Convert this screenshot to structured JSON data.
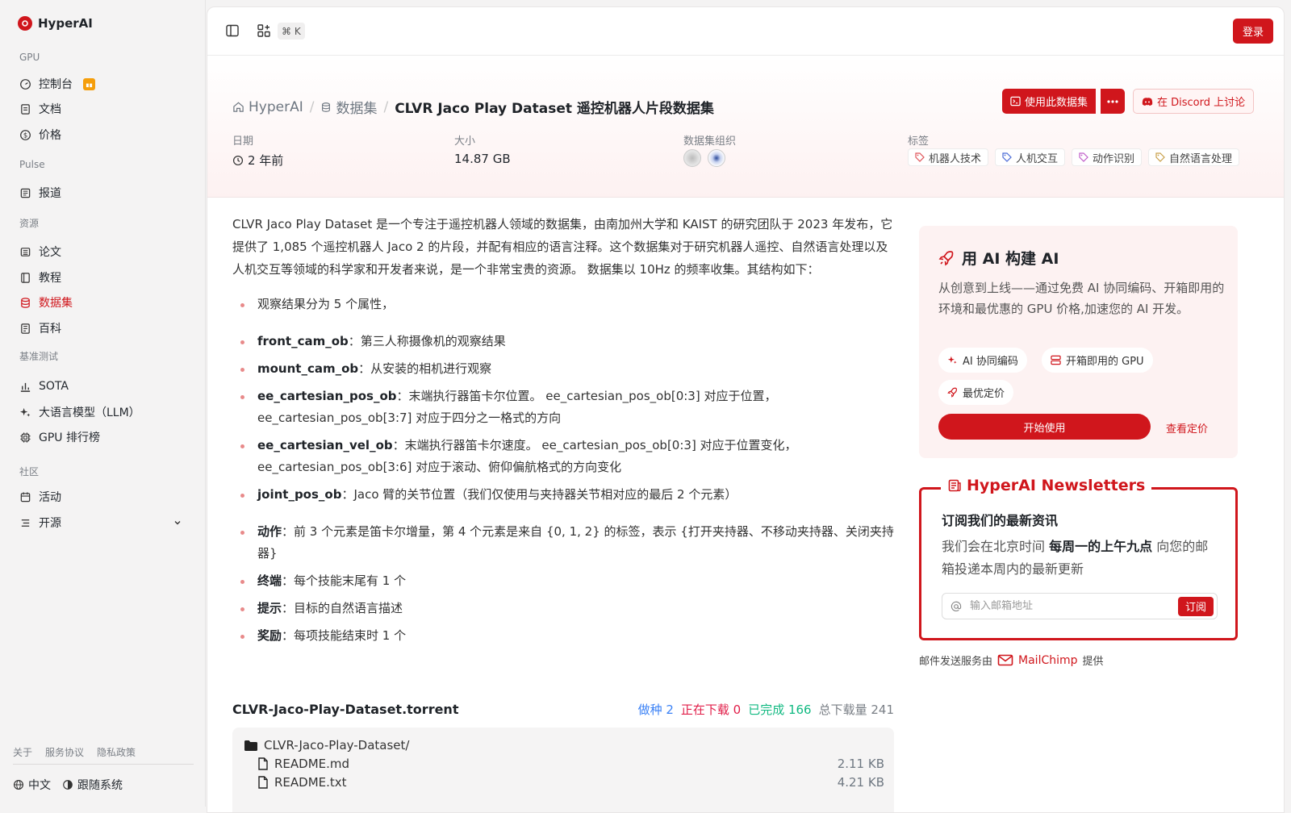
{
  "app": {
    "name": "HyperAI"
  },
  "sidebar": {
    "sections": [
      {
        "label": "GPU"
      },
      {
        "label": "Pulse"
      },
      {
        "label": "资源"
      },
      {
        "label": "基准测试"
      },
      {
        "label": "社区"
      }
    ],
    "items": [
      {
        "label": "控制台",
        "icon": "dashboard-icon"
      },
      {
        "label": "文档",
        "icon": "document-icon"
      },
      {
        "label": "价格",
        "icon": "dollar-icon"
      },
      {
        "label": "报道",
        "icon": "newspaper-icon"
      },
      {
        "label": "论文",
        "icon": "paper-icon"
      },
      {
        "label": "教程",
        "icon": "book-icon"
      },
      {
        "label": "数据集",
        "icon": "database-icon",
        "active": true
      },
      {
        "label": "百科",
        "icon": "wiki-icon"
      },
      {
        "label": "SOTA",
        "icon": "chart-bar-icon"
      },
      {
        "label": "大语言模型（LLM）",
        "icon": "sparkle-icon"
      },
      {
        "label": "GPU 排行榜",
        "icon": "chip-icon"
      },
      {
        "label": "活动",
        "icon": "calendar-icon"
      },
      {
        "label": "开源",
        "icon": "list-icon"
      }
    ],
    "footer_links": [
      "关于",
      "服务协议",
      "隐私政策"
    ],
    "language": "中文",
    "theme": "跟随系统"
  },
  "topbar": {
    "shortcut": "⌘ K",
    "login_label": "登录"
  },
  "breadcrumb": {
    "home": "HyperAI",
    "section": "数据集",
    "current": "CLVR Jaco Play Dataset 遥控机器人片段数据集"
  },
  "actions": {
    "use_dataset": "使用此数据集",
    "discord": "在 Discord 上讨论"
  },
  "meta": {
    "date_label": "日期",
    "date_value": "2 年前",
    "size_label": "大小",
    "size_value": "14.87 GB",
    "org_label": "数据集组织",
    "tags_label": "标签",
    "tags": [
      "机器人技术",
      "人机交互",
      "动作识别",
      "自然语言处理"
    ]
  },
  "description": "CLVR Jaco Play Dataset 是一个专注于遥控机器人领域的数据集，由南加州大学和 KAIST 的研究团队于 2023 年发布，它提供了 1,085 个遥控机器人 Jaco 2 的片段，并配有相应的语言注释。这个数据集对于研究机器人遥控、自然语言处理以及人机交互等领域的科学家和开发者来说，是一个非常宝贵的资源。 数据集以 10Hz 的频率收集。其结构如下：",
  "structure": [
    {
      "key": "",
      "text": "观察结果分为 5 个属性，"
    },
    {
      "key": "front_cam_ob",
      "text": "：第三人称摄像机的观察结果"
    },
    {
      "key": "mount_cam_ob",
      "text": "：从安装的相机进行观察"
    },
    {
      "key": "ee_cartesian_pos_ob",
      "text": "：末端执行器笛卡尔位置。 ee_cartesian_pos_ob[0:3] 对应于位置， ee_cartesian_pos_ob[3:7] 对应于四分之一格式的方向"
    },
    {
      "key": "ee_cartesian_vel_ob",
      "text": "：末端执行器笛卡尔速度。 ee_cartesian_pos_ob[0:3] 对应于位置变化， ee_cartesian_pos_ob[3:6] 对应于滚动、俯仰偏航格式的方向变化"
    },
    {
      "key": "joint_pos_ob",
      "text": "：Jaco 臂的关节位置（我们仅使用与夹持器关节相对应的最后 2 个元素）"
    },
    {
      "key": "动作",
      "text": "：前 3 个元素是笛卡尔增量，第 4 个元素是来自 {0, 1, 2} 的标签，表示 {打开夹持器、不移动夹持器、关闭夹持器}"
    },
    {
      "key": "终端",
      "text": "：每个技能末尾有 1 个"
    },
    {
      "key": "提示",
      "text": "：目标的自然语言描述"
    },
    {
      "key": "奖励",
      "text": "：每项技能结束时 1 个"
    }
  ],
  "torrent": {
    "name": "CLVR-Jaco-Play-Dataset.torrent",
    "seeding": "做种 2",
    "downloading": "正在下载 0",
    "completed": "已完成 166",
    "total": "总下载量 241",
    "folder": "CLVR-Jaco-Play-Dataset/",
    "files": [
      {
        "name": "README.md",
        "size": "2.11 KB"
      },
      {
        "name": "README.txt",
        "size": "4.21 KB"
      }
    ]
  },
  "promo": {
    "title": "用 AI 构建 AI",
    "desc": "从创意到上线——通过免费 AI 协同编码、开箱即用的环境和最优惠的 GPU 价格,加速您的 AI 开发。",
    "chips": [
      "AI 协同编码",
      "开箱即用的 GPU",
      "最优定价"
    ],
    "start": "开始使用",
    "pricing": "查看定价"
  },
  "newsletter": {
    "title": "HyperAI Newsletters",
    "subtitle": "订阅我们的最新资讯",
    "desc_pre": "我们会在北京时间 ",
    "desc_bold": "每周一的上午九点",
    "desc_post": " 向您的邮箱投递本周内的最新更新",
    "placeholder": "输入邮箱地址",
    "button": "订阅",
    "footer_pre": "邮件发送服务由",
    "provider": "MailChimp",
    "footer_post": "提供"
  },
  "colors": {
    "accent": "#d0161c"
  }
}
